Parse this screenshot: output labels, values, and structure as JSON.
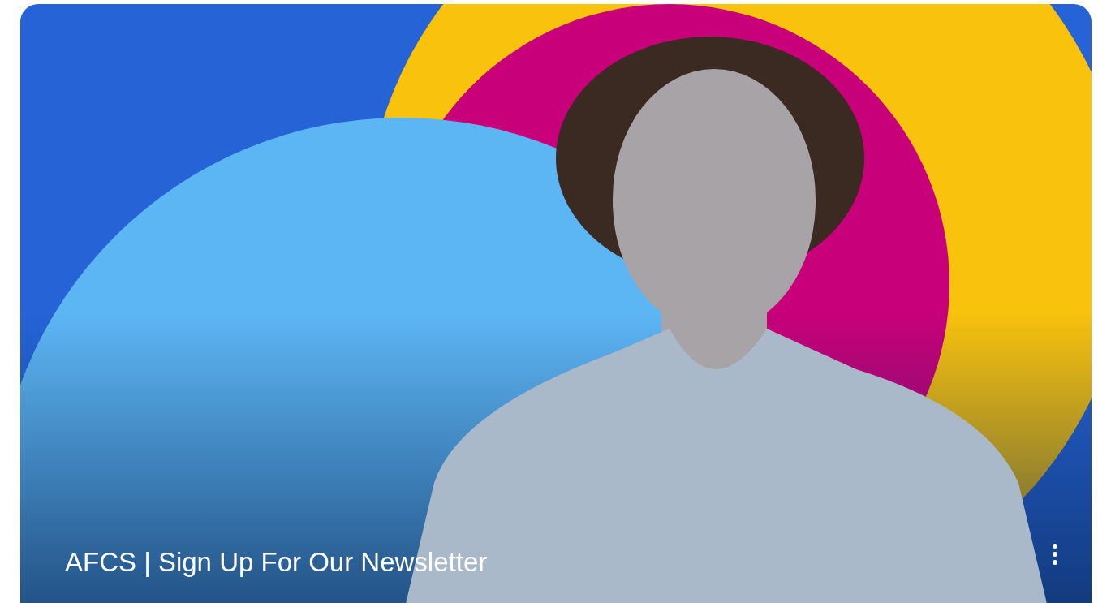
{
  "card": {
    "title": "AFCS | Sign Up For Our Newsletter"
  }
}
